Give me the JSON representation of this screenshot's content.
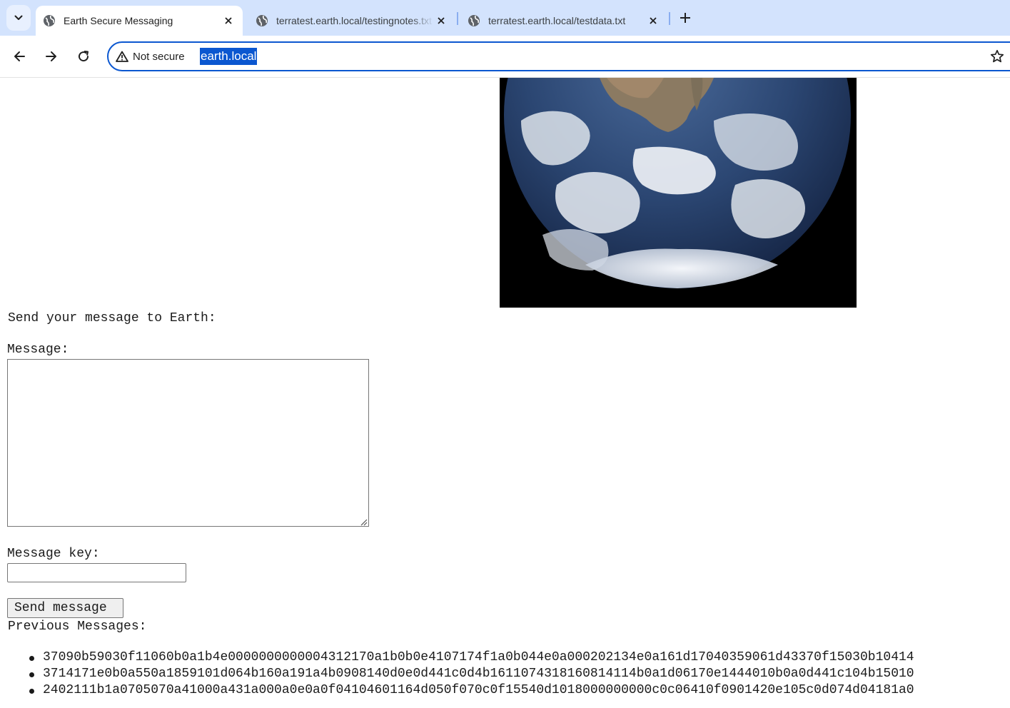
{
  "browser": {
    "tabs": [
      {
        "title": "Earth Secure Messaging",
        "active": true
      },
      {
        "title": "terratest.earth.local/testingnotes.txt",
        "active": false
      },
      {
        "title": "terratest.earth.local/testdata.txt",
        "active": false
      }
    ],
    "security_label": "Not secure",
    "url": "earth.local"
  },
  "page": {
    "prompt": "Send your message to Earth:",
    "message_label": "Message:",
    "message_value": "",
    "key_label": "Message key:",
    "key_value": "",
    "send_label": "Send message",
    "previous_label": "Previous Messages:",
    "previous_messages": [
      "37090b59030f11060b0a1b4e0000000000004312170a1b0b0e4107174f1a0b044e0a000202134e0a161d17040359061d43370f15030b10414",
      "3714171e0b0a550a1859101d064b160a191a4b0908140d0e0d441c0d4b1611074318160814114b0a1d06170e1444010b0a0d441c104b15010",
      "2402111b1a0705070a41000a431a000a0e0a0f04104601164d050f070c0f15540d1018000000000c0c06410f0901420e105c0d074d04181a0"
    ]
  },
  "colors": {
    "tabstrip": "#d3e3fd",
    "accent": "#0b57d0",
    "text": "#1a1a1a"
  }
}
